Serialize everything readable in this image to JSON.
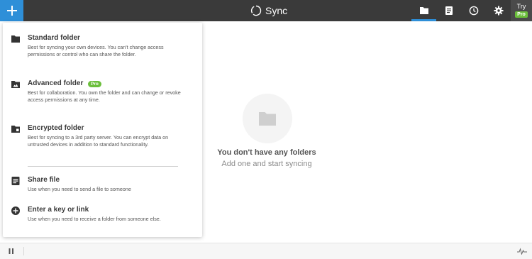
{
  "topbar": {
    "app_name": "Sync",
    "try_label": "Try",
    "pro_label": "Pro"
  },
  "menu": {
    "items": [
      {
        "icon": "folder-icon",
        "title": "Standard folder",
        "desc": "Best for syncing your own devices. You can't change access permissions or control who can share the folder."
      },
      {
        "icon": "advanced-folder-icon",
        "title": "Advanced folder",
        "badge": "Pro",
        "desc": "Best for collaboration. You own the folder and can change or revoke access permissions at any time."
      },
      {
        "icon": "encrypted-folder-icon",
        "title": "Encrypted folder",
        "desc": "Best for syncing to a 3rd party server. You can encrypt data on untrusted devices in addition to standard functionality."
      },
      {
        "icon": "file-icon",
        "title": "Share file",
        "desc": "Use when you need to send a file to someone"
      },
      {
        "icon": "plus-circle-icon",
        "title": "Enter a key or link",
        "desc": "Use when you need to receive a folder from someone else."
      }
    ]
  },
  "empty_state": {
    "title": "You don't have any folders",
    "subtitle": "Add one and start syncing"
  },
  "colors": {
    "topbar": "#3a3a3a",
    "accent": "#2e8fd8",
    "pro_green": "#6bbf3b"
  }
}
